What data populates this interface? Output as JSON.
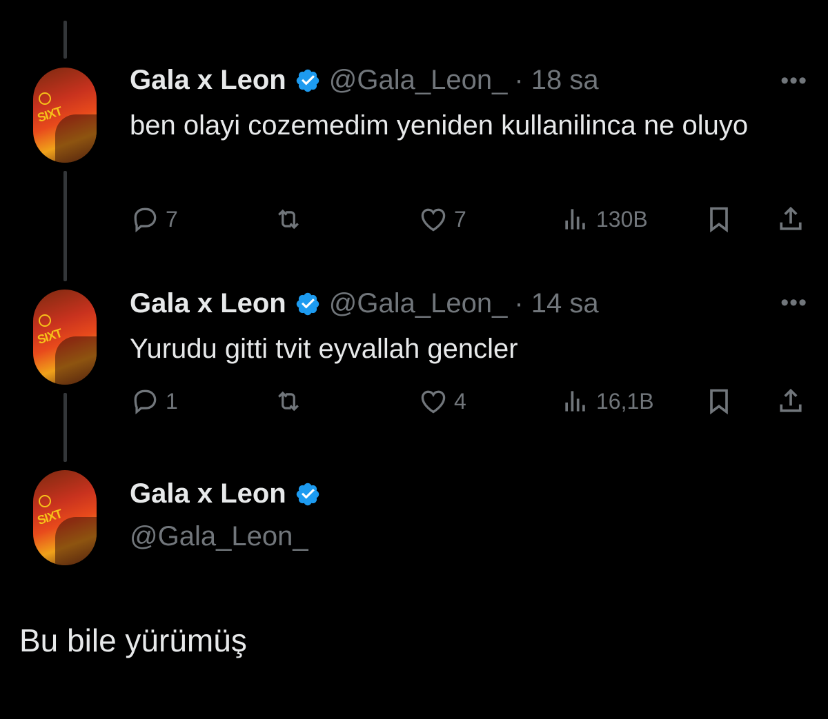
{
  "tweets": [
    {
      "name": "Gala x Leon",
      "handle": "@Gala_Leon_",
      "time": "· 18 sa",
      "text": "ben olayi cozemedim yeniden kullanilinca ne oluyo",
      "replies": "7",
      "retweets": "",
      "likes": "7",
      "views": "130B"
    },
    {
      "name": "Gala x Leon",
      "handle": "@Gala_Leon_",
      "time": "· 14 sa",
      "text": "Yurudu gitti tvit eyvallah gencler",
      "replies": "1",
      "retweets": "",
      "likes": "4",
      "views": "16,1B"
    }
  ],
  "profile": {
    "name": "Gala x Leon",
    "handle": "@Gala_Leon_"
  },
  "avatar_text": "SIXT",
  "caption": "Bu bile yürümüş",
  "colors": {
    "background": "#000000",
    "text": "#e7e9ea",
    "muted": "#71767b",
    "verified": "#1d9bf0",
    "thread_line": "#333639"
  },
  "icons": [
    "reply-icon",
    "retweet-icon",
    "like-icon",
    "views-icon",
    "bookmark-icon",
    "share-icon",
    "more-icon",
    "verified-badge-icon"
  ]
}
